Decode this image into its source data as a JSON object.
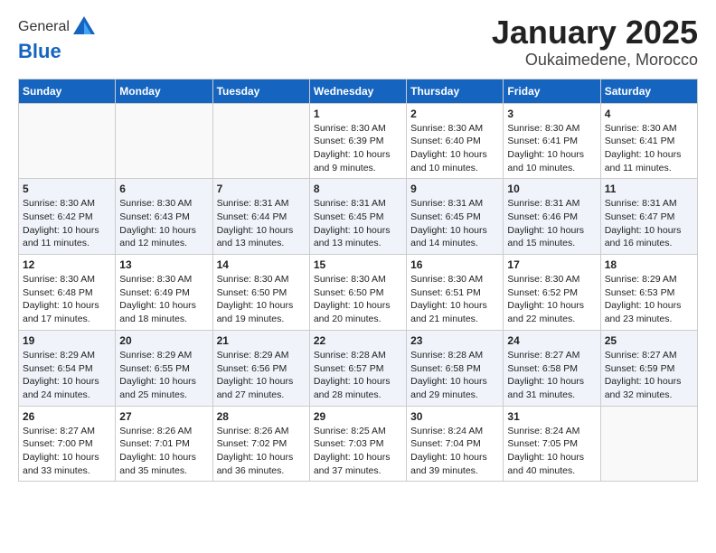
{
  "header": {
    "logo_general": "General",
    "logo_blue": "Blue",
    "title": "January 2025",
    "subtitle": "Oukaimedene, Morocco"
  },
  "days_of_week": [
    "Sunday",
    "Monday",
    "Tuesday",
    "Wednesday",
    "Thursday",
    "Friday",
    "Saturday"
  ],
  "weeks": [
    [
      {
        "day": "",
        "sunrise": "",
        "sunset": "",
        "daylight": "",
        "empty": true
      },
      {
        "day": "",
        "sunrise": "",
        "sunset": "",
        "daylight": "",
        "empty": true
      },
      {
        "day": "",
        "sunrise": "",
        "sunset": "",
        "daylight": "",
        "empty": true
      },
      {
        "day": "1",
        "sunrise": "Sunrise: 8:30 AM",
        "sunset": "Sunset: 6:39 PM",
        "daylight": "Daylight: 10 hours and 9 minutes.",
        "empty": false
      },
      {
        "day": "2",
        "sunrise": "Sunrise: 8:30 AM",
        "sunset": "Sunset: 6:40 PM",
        "daylight": "Daylight: 10 hours and 10 minutes.",
        "empty": false
      },
      {
        "day": "3",
        "sunrise": "Sunrise: 8:30 AM",
        "sunset": "Sunset: 6:41 PM",
        "daylight": "Daylight: 10 hours and 10 minutes.",
        "empty": false
      },
      {
        "day": "4",
        "sunrise": "Sunrise: 8:30 AM",
        "sunset": "Sunset: 6:41 PM",
        "daylight": "Daylight: 10 hours and 11 minutes.",
        "empty": false
      }
    ],
    [
      {
        "day": "5",
        "sunrise": "Sunrise: 8:30 AM",
        "sunset": "Sunset: 6:42 PM",
        "daylight": "Daylight: 10 hours and 11 minutes.",
        "empty": false
      },
      {
        "day": "6",
        "sunrise": "Sunrise: 8:30 AM",
        "sunset": "Sunset: 6:43 PM",
        "daylight": "Daylight: 10 hours and 12 minutes.",
        "empty": false
      },
      {
        "day": "7",
        "sunrise": "Sunrise: 8:31 AM",
        "sunset": "Sunset: 6:44 PM",
        "daylight": "Daylight: 10 hours and 13 minutes.",
        "empty": false
      },
      {
        "day": "8",
        "sunrise": "Sunrise: 8:31 AM",
        "sunset": "Sunset: 6:45 PM",
        "daylight": "Daylight: 10 hours and 13 minutes.",
        "empty": false
      },
      {
        "day": "9",
        "sunrise": "Sunrise: 8:31 AM",
        "sunset": "Sunset: 6:45 PM",
        "daylight": "Daylight: 10 hours and 14 minutes.",
        "empty": false
      },
      {
        "day": "10",
        "sunrise": "Sunrise: 8:31 AM",
        "sunset": "Sunset: 6:46 PM",
        "daylight": "Daylight: 10 hours and 15 minutes.",
        "empty": false
      },
      {
        "day": "11",
        "sunrise": "Sunrise: 8:31 AM",
        "sunset": "Sunset: 6:47 PM",
        "daylight": "Daylight: 10 hours and 16 minutes.",
        "empty": false
      }
    ],
    [
      {
        "day": "12",
        "sunrise": "Sunrise: 8:30 AM",
        "sunset": "Sunset: 6:48 PM",
        "daylight": "Daylight: 10 hours and 17 minutes.",
        "empty": false
      },
      {
        "day": "13",
        "sunrise": "Sunrise: 8:30 AM",
        "sunset": "Sunset: 6:49 PM",
        "daylight": "Daylight: 10 hours and 18 minutes.",
        "empty": false
      },
      {
        "day": "14",
        "sunrise": "Sunrise: 8:30 AM",
        "sunset": "Sunset: 6:50 PM",
        "daylight": "Daylight: 10 hours and 19 minutes.",
        "empty": false
      },
      {
        "day": "15",
        "sunrise": "Sunrise: 8:30 AM",
        "sunset": "Sunset: 6:50 PM",
        "daylight": "Daylight: 10 hours and 20 minutes.",
        "empty": false
      },
      {
        "day": "16",
        "sunrise": "Sunrise: 8:30 AM",
        "sunset": "Sunset: 6:51 PM",
        "daylight": "Daylight: 10 hours and 21 minutes.",
        "empty": false
      },
      {
        "day": "17",
        "sunrise": "Sunrise: 8:30 AM",
        "sunset": "Sunset: 6:52 PM",
        "daylight": "Daylight: 10 hours and 22 minutes.",
        "empty": false
      },
      {
        "day": "18",
        "sunrise": "Sunrise: 8:29 AM",
        "sunset": "Sunset: 6:53 PM",
        "daylight": "Daylight: 10 hours and 23 minutes.",
        "empty": false
      }
    ],
    [
      {
        "day": "19",
        "sunrise": "Sunrise: 8:29 AM",
        "sunset": "Sunset: 6:54 PM",
        "daylight": "Daylight: 10 hours and 24 minutes.",
        "empty": false
      },
      {
        "day": "20",
        "sunrise": "Sunrise: 8:29 AM",
        "sunset": "Sunset: 6:55 PM",
        "daylight": "Daylight: 10 hours and 25 minutes.",
        "empty": false
      },
      {
        "day": "21",
        "sunrise": "Sunrise: 8:29 AM",
        "sunset": "Sunset: 6:56 PM",
        "daylight": "Daylight: 10 hours and 27 minutes.",
        "empty": false
      },
      {
        "day": "22",
        "sunrise": "Sunrise: 8:28 AM",
        "sunset": "Sunset: 6:57 PM",
        "daylight": "Daylight: 10 hours and 28 minutes.",
        "empty": false
      },
      {
        "day": "23",
        "sunrise": "Sunrise: 8:28 AM",
        "sunset": "Sunset: 6:58 PM",
        "daylight": "Daylight: 10 hours and 29 minutes.",
        "empty": false
      },
      {
        "day": "24",
        "sunrise": "Sunrise: 8:27 AM",
        "sunset": "Sunset: 6:58 PM",
        "daylight": "Daylight: 10 hours and 31 minutes.",
        "empty": false
      },
      {
        "day": "25",
        "sunrise": "Sunrise: 8:27 AM",
        "sunset": "Sunset: 6:59 PM",
        "daylight": "Daylight: 10 hours and 32 minutes.",
        "empty": false
      }
    ],
    [
      {
        "day": "26",
        "sunrise": "Sunrise: 8:27 AM",
        "sunset": "Sunset: 7:00 PM",
        "daylight": "Daylight: 10 hours and 33 minutes.",
        "empty": false
      },
      {
        "day": "27",
        "sunrise": "Sunrise: 8:26 AM",
        "sunset": "Sunset: 7:01 PM",
        "daylight": "Daylight: 10 hours and 35 minutes.",
        "empty": false
      },
      {
        "day": "28",
        "sunrise": "Sunrise: 8:26 AM",
        "sunset": "Sunset: 7:02 PM",
        "daylight": "Daylight: 10 hours and 36 minutes.",
        "empty": false
      },
      {
        "day": "29",
        "sunrise": "Sunrise: 8:25 AM",
        "sunset": "Sunset: 7:03 PM",
        "daylight": "Daylight: 10 hours and 37 minutes.",
        "empty": false
      },
      {
        "day": "30",
        "sunrise": "Sunrise: 8:24 AM",
        "sunset": "Sunset: 7:04 PM",
        "daylight": "Daylight: 10 hours and 39 minutes.",
        "empty": false
      },
      {
        "day": "31",
        "sunrise": "Sunrise: 8:24 AM",
        "sunset": "Sunset: 7:05 PM",
        "daylight": "Daylight: 10 hours and 40 minutes.",
        "empty": false
      },
      {
        "day": "",
        "sunrise": "",
        "sunset": "",
        "daylight": "",
        "empty": true
      }
    ]
  ]
}
